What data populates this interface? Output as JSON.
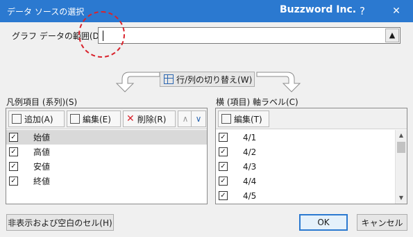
{
  "window": {
    "title": "データ ソースの選択",
    "brand": "Buzzword Inc.",
    "help_glyph": "?",
    "close_glyph": "✕"
  },
  "range": {
    "label": "グラフ データの範囲(D):",
    "value": "",
    "collapse_glyph": "▲"
  },
  "switch_button": {
    "label": "行/列の切り替え(W)"
  },
  "legend": {
    "label": "凡例項目 (系列)(S)",
    "toolbar": {
      "add": "追加(A)",
      "edit": "編集(E)",
      "delete": "削除(R)",
      "up_glyph": "∧",
      "down_glyph": "∨"
    },
    "items": [
      {
        "label": "始値",
        "checked": true,
        "selected": true
      },
      {
        "label": "高値",
        "checked": true,
        "selected": false
      },
      {
        "label": "安値",
        "checked": true,
        "selected": false
      },
      {
        "label": "終値",
        "checked": true,
        "selected": false
      }
    ]
  },
  "axis": {
    "label": "横 (項目) 軸ラベル(C)",
    "toolbar": {
      "edit": "編集(T)"
    },
    "items": [
      {
        "label": "4/1",
        "checked": true
      },
      {
        "label": "4/2",
        "checked": true
      },
      {
        "label": "4/3",
        "checked": true
      },
      {
        "label": "4/4",
        "checked": true
      },
      {
        "label": "4/5",
        "checked": true
      }
    ]
  },
  "footer": {
    "hidden_cells": "非表示および空白のセル(H)",
    "ok": "OK",
    "cancel": "キャンセル"
  },
  "colors": {
    "titlebar": "#2b79d0",
    "highlight_circle": "#d9232d"
  },
  "icons": [
    "help-icon",
    "close-icon",
    "collapse-icon",
    "switch-icon",
    "add-icon",
    "edit-icon",
    "delete-icon",
    "move-up-icon",
    "move-down-icon",
    "checkbox-icon"
  ]
}
